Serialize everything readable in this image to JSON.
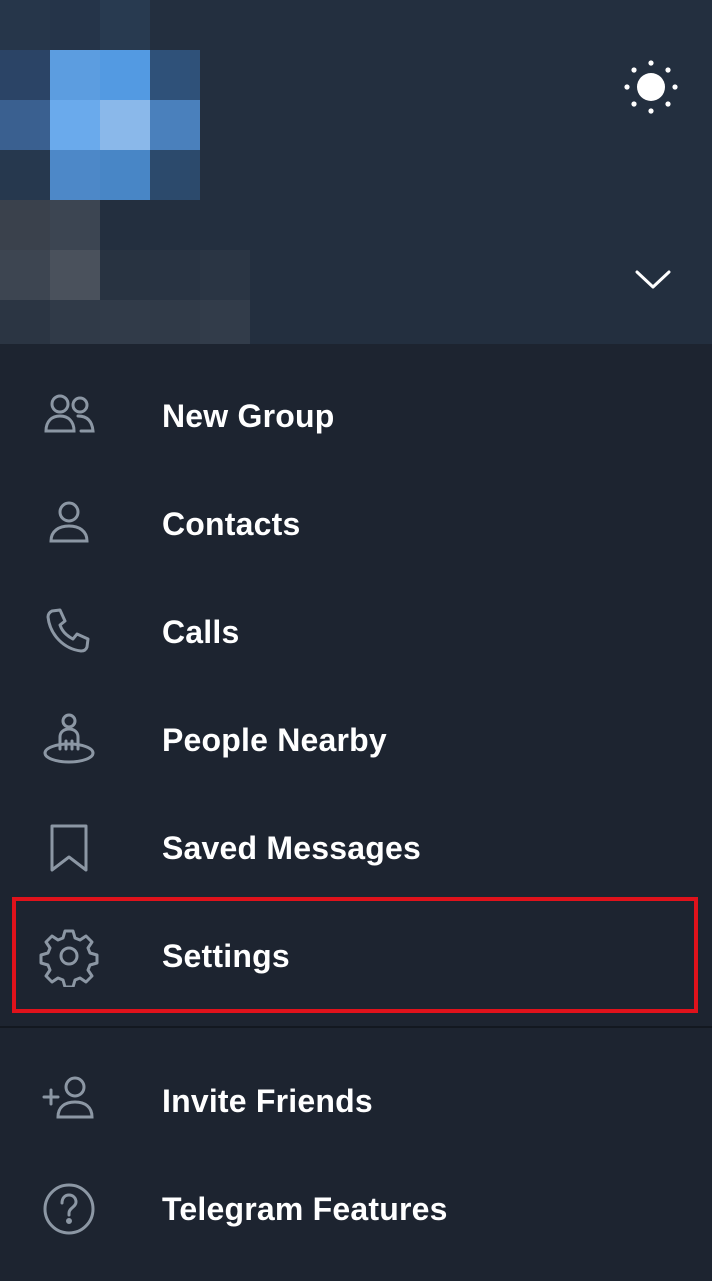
{
  "header": {
    "theme_icon": "sun-icon",
    "expand_icon": "chevron-down-icon",
    "avatar": "pixelated-avatar"
  },
  "menu": {
    "items": [
      {
        "label": "New Group",
        "icon": "group-icon"
      },
      {
        "label": "Contacts",
        "icon": "person-icon"
      },
      {
        "label": "Calls",
        "icon": "phone-icon"
      },
      {
        "label": "People Nearby",
        "icon": "people-nearby-icon"
      },
      {
        "label": "Saved Messages",
        "icon": "bookmark-icon"
      },
      {
        "label": "Settings",
        "icon": "gear-icon"
      },
      {
        "label": "Invite Friends",
        "icon": "add-person-icon"
      },
      {
        "label": "Telegram Features",
        "icon": "question-icon"
      }
    ]
  },
  "colors": {
    "background": "#1d2430",
    "header": "#232f3f",
    "icon": "#8c97a4",
    "highlight": "#e0121b"
  }
}
